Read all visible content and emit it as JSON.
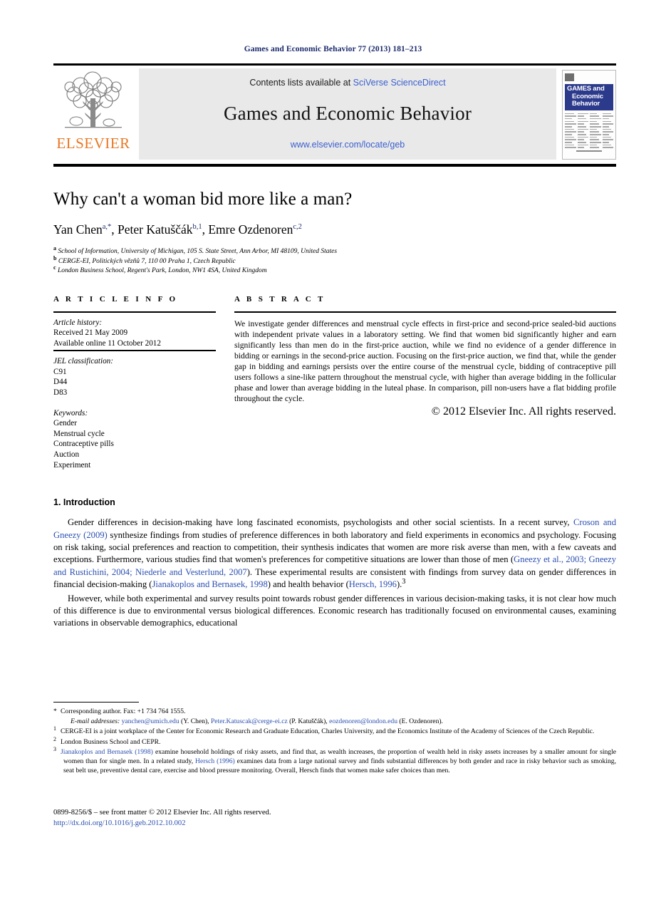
{
  "running_head": "Games and Economic Behavior 77 (2013) 181–213",
  "masthead": {
    "publisher": "ELSEVIER",
    "contents_prefix": "Contents lists available at ",
    "contents_link": "SciVerse ScienceDirect",
    "journal_name": "Games and Economic Behavior",
    "journal_url": "www.elsevier.com/locate/geb",
    "cover": {
      "line1": "GAMES and",
      "line2": "Economic",
      "line3": "Behavior"
    }
  },
  "article": {
    "title": "Why can't a woman bid more like a man?",
    "authors": [
      {
        "name": "Yan Chen",
        "marks": "a,*"
      },
      {
        "name": "Peter Katuščák",
        "marks": "b,1"
      },
      {
        "name": "Emre Ozdenoren",
        "marks": "c,2"
      }
    ],
    "authors_line": "Yan Chen, Peter Katuščák, Emre Ozdenoren",
    "affiliations": [
      {
        "mark": "a",
        "text": "School of Information, University of Michigan, 105 S. State Street, Ann Arbor, MI 48109, United States"
      },
      {
        "mark": "b",
        "text": "CERGE-EI, Politických vězňů 7, 110 00 Praha 1, Czech Republic"
      },
      {
        "mark": "c",
        "text": "London Business School, Regent's Park, London, NW1 4SA, United Kingdom"
      }
    ]
  },
  "article_info": {
    "heading": "A R T I C L E   I N F O",
    "history_label": "Article history:",
    "history": [
      "Received 21 May 2009",
      "Available online 11 October 2012"
    ],
    "jel_label": "JEL classification:",
    "jel": [
      "C91",
      "D44",
      "D83"
    ],
    "keywords_label": "Keywords:",
    "keywords": [
      "Gender",
      "Menstrual cycle",
      "Contraceptive pills",
      "Auction",
      "Experiment"
    ]
  },
  "abstract": {
    "heading": "A B S T R A C T",
    "text": "We investigate gender differences and menstrual cycle effects in first-price and second-price sealed-bid auctions with independent private values in a laboratory setting. We find that women bid significantly higher and earn significantly less than men do in the first-price auction, while we find no evidence of a gender difference in bidding or earnings in the second-price auction. Focusing on the first-price auction, we find that, while the gender gap in bidding and earnings persists over the entire course of the menstrual cycle, bidding of contraceptive pill users follows a sine-like pattern throughout the menstrual cycle, with higher than average bidding in the follicular phase and lower than average bidding in the luteal phase. In comparison, pill non-users have a flat bidding profile throughout the cycle.",
    "copyright": "© 2012 Elsevier Inc. All rights reserved."
  },
  "introduction": {
    "heading": "1. Introduction",
    "p1_a": "Gender differences in decision-making have long fascinated economists, psychologists and other social scientists. In a recent survey, ",
    "p1_cite1": "Croson and Gneezy (2009)",
    "p1_b": " synthesize findings from studies of preference differences in both laboratory and field experiments in economics and psychology. Focusing on risk taking, social preferences and reaction to competition, their synthesis indicates that women are more risk averse than men, with a few caveats and exceptions. Furthermore, various studies find that women's preferences for competitive situations are lower than those of men (",
    "p1_cite2": "Gneezy et al., 2003; Gneezy and Rustichini, 2004; Niederle and Vesterlund, 2007",
    "p1_c": "). These experimental results are consistent with findings from survey data on gender differences in financial decision-making (",
    "p1_cite3": "Jianakoplos and Bernasek, 1998",
    "p1_d": ") and health behavior (",
    "p1_cite4": "Hersch, 1996",
    "p1_e": ").",
    "p1_fnmark": "3",
    "p2": "However, while both experimental and survey results point towards robust gender differences in various decision-making tasks, it is not clear how much of this difference is due to environmental versus biological differences. Economic research has traditionally focused on environmental causes, examining variations in observable demographics, educational"
  },
  "footnotes": {
    "corresponding": "Corresponding author. Fax: +1 734 764 1555.",
    "email_label": "E-mail addresses:",
    "emails": [
      {
        "address": "yanchen@umich.edu",
        "person": " (Y. Chen), "
      },
      {
        "address": "Peter.Katuscak@cerge-ei.cz",
        "person": " (P. Katuščák), "
      },
      {
        "address": "eozdenoren@london.edu",
        "person": " (E. Ozdenoren)."
      }
    ],
    "fn1": "CERGE-EI is a joint workplace of the Center for Economic Research and Graduate Education, Charles University, and the Economics Institute of the Academy of Sciences of the Czech Republic.",
    "fn2": "London Business School and CEPR.",
    "fn3_cite1": "Jianakoplos and Bernasek (1998)",
    "fn3_a": " examine household holdings of risky assets, and find that, as wealth increases, the proportion of wealth held in risky assets increases by a smaller amount for single women than for single men. In a related study, ",
    "fn3_cite2": "Hersch (1996)",
    "fn3_b": " examines data from a large national survey and finds substantial differences by both gender and race in risky behavior such as smoking, seat belt use, preventive dental care, exercise and blood pressure monitoring. Overall, Hersch finds that women make safer choices than men."
  },
  "bottom": {
    "issn_line": "0899-8256/$ – see front matter  © 2012 Elsevier Inc. All rights reserved.",
    "doi": "http://dx.doi.org/10.1016/j.geb.2012.10.002"
  },
  "colors": {
    "link": "#2b4fb0",
    "runhead": "#1b2a6b",
    "elsevier_orange": "#e87722",
    "cover_blue": "#2c3a8c"
  }
}
